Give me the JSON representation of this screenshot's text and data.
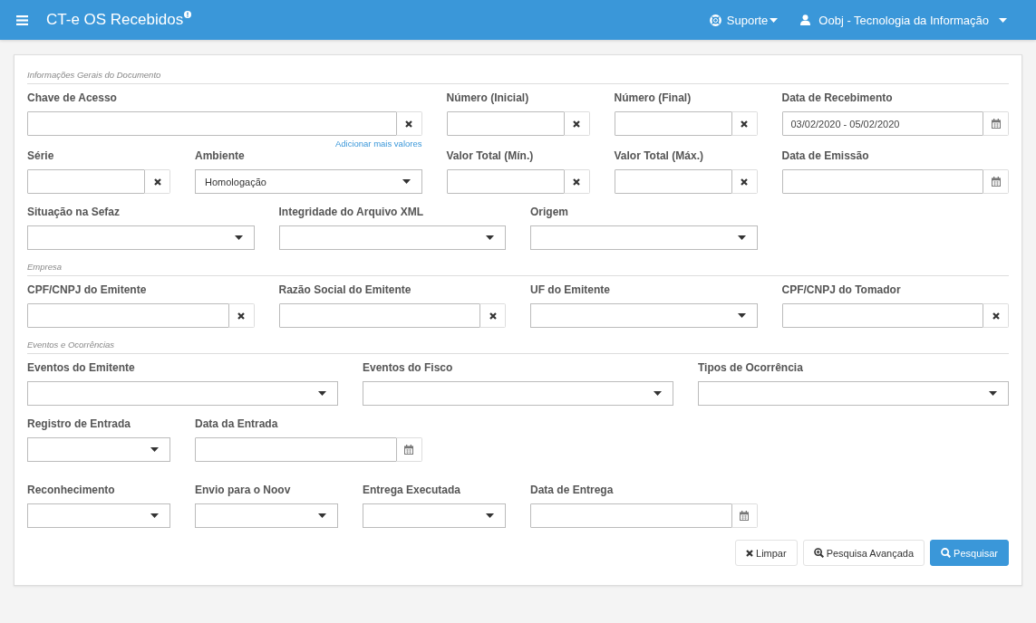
{
  "header": {
    "title": "CT-e OS Recebidos",
    "support": "Suporte",
    "user": "Oobj - Tecnologia da Informação"
  },
  "sections": [
    {
      "title": "Informações Gerais do Documento",
      "fields": [
        {
          "label": "Chave de Acesso",
          "kind": "text",
          "link": "Adicionar mais valores"
        },
        {
          "label": "Número (Inicial)",
          "kind": "text"
        },
        {
          "label": "Número (Final)",
          "kind": "text"
        },
        {
          "label": "Data de Recebimento",
          "kind": "date",
          "value": "03/02/2020 - 05/02/2020"
        },
        {
          "label": "Série",
          "kind": "text"
        },
        {
          "label": "Ambiente",
          "kind": "select",
          "value": "Homologação"
        },
        {
          "label": "Valor Total (Mín.)",
          "kind": "text"
        },
        {
          "label": "Valor Total (Máx.)",
          "kind": "text"
        },
        {
          "label": "Data de Emissão",
          "kind": "date"
        },
        {
          "label": "Situação na Sefaz",
          "kind": "select"
        },
        {
          "label": "Integridade do Arquivo XML",
          "kind": "select"
        },
        {
          "label": "Origem",
          "kind": "select"
        }
      ]
    },
    {
      "title": "Empresa",
      "fields": [
        {
          "label": "CPF/CNPJ do Emitente",
          "kind": "text"
        },
        {
          "label": "Razão Social do Emitente",
          "kind": "text"
        },
        {
          "label": "UF do Emitente",
          "kind": "select"
        },
        {
          "label": "CPF/CNPJ do Tomador",
          "kind": "text"
        }
      ]
    },
    {
      "title": "Eventos e Ocorrências",
      "fields": [
        {
          "label": "Eventos do Emitente",
          "kind": "select"
        },
        {
          "label": "Eventos do Fisco",
          "kind": "select"
        },
        {
          "label": "Tipos de Ocorrência",
          "kind": "select"
        },
        {
          "label": "Registro de Entrada",
          "kind": "select"
        },
        {
          "label": "Data da Entrada",
          "kind": "date"
        },
        {
          "label": "Reconhecimento",
          "kind": "select"
        },
        {
          "label": "Envio para o Noov",
          "kind": "select"
        },
        {
          "label": "Entrega Executada",
          "kind": "select"
        },
        {
          "label": "Data de Entrega",
          "kind": "date"
        }
      ]
    }
  ],
  "buttons": [
    {
      "label": "Limpar",
      "kind": "default"
    },
    {
      "label": "Pesquisa Avançada",
      "kind": "default"
    },
    {
      "label": "Pesquisar",
      "kind": "primary"
    }
  ]
}
